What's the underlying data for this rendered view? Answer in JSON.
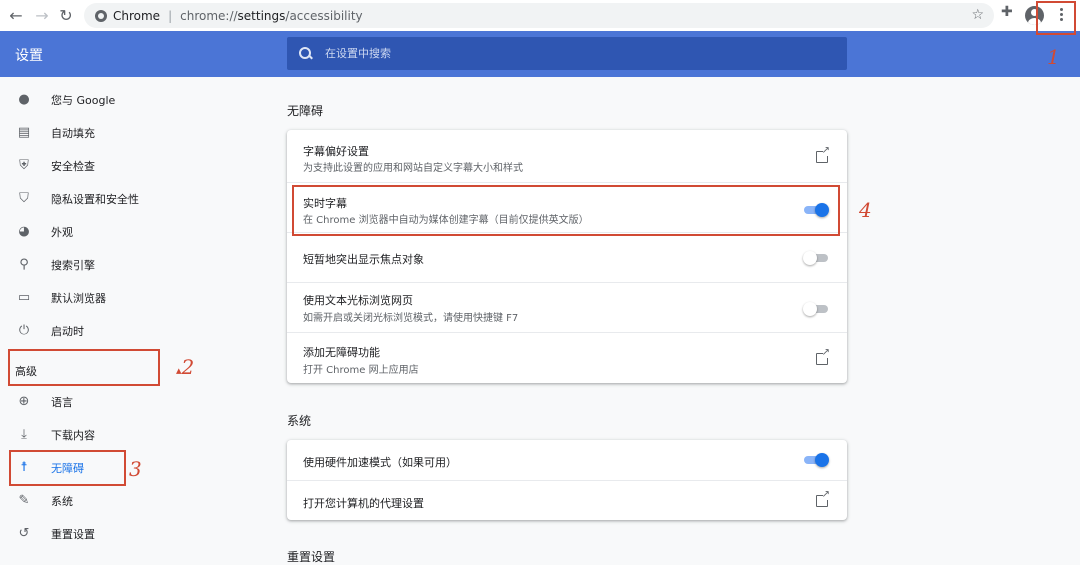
{
  "browser": {
    "tab_label": "Chrome",
    "url_prefix": "chrome://",
    "url_page": "settings",
    "url_suffix": "/accessibility"
  },
  "header": {
    "title": "设置",
    "search_placeholder": "在设置中搜索"
  },
  "sidebar": {
    "items": [
      {
        "label": "您与 Google",
        "icon": "person-icon"
      },
      {
        "label": "自动填充",
        "icon": "clipboard-icon"
      },
      {
        "label": "安全检查",
        "icon": "shield-check-icon"
      },
      {
        "label": "隐私设置和安全性",
        "icon": "shield-icon"
      },
      {
        "label": "外观",
        "icon": "palette-icon"
      },
      {
        "label": "搜索引擎",
        "icon": "search-icon"
      },
      {
        "label": "默认浏览器",
        "icon": "browser-icon"
      },
      {
        "label": "启动时",
        "icon": "power-icon"
      }
    ],
    "advanced_label": "高级",
    "advanced_items": [
      {
        "label": "语言",
        "icon": "globe-icon"
      },
      {
        "label": "下载内容",
        "icon": "download-icon"
      },
      {
        "label": "无障碍",
        "icon": "accessibility-icon",
        "active": true
      },
      {
        "label": "系统",
        "icon": "wrench-icon"
      },
      {
        "label": "重置设置",
        "icon": "restore-icon"
      }
    ]
  },
  "accessibility": {
    "section_title": "无障碍",
    "rows": [
      {
        "title": "字幕偏好设置",
        "subtitle": "为支持此设置的应用和网站自定义字幕大小和样式",
        "control": "external"
      },
      {
        "title": "实时字幕",
        "subtitle": "在 Chrome 浏览器中自动为媒体创建字幕（目前仅提供英文版）",
        "control": "toggle",
        "on": true
      },
      {
        "title": "短暂地突出显示焦点对象",
        "control": "toggle",
        "on": false
      },
      {
        "title": "使用文本光标浏览网页",
        "subtitle": "如需开启或关闭光标浏览模式，请使用快捷键 F7",
        "control": "toggle",
        "on": false
      },
      {
        "title": "添加无障碍功能",
        "subtitle": "打开 Chrome 网上应用店",
        "control": "external"
      }
    ]
  },
  "system": {
    "section_title": "系统",
    "rows": [
      {
        "title": "使用硬件加速模式（如果可用）",
        "control": "toggle",
        "on": true
      },
      {
        "title": "打开您计算机的代理设置",
        "control": "external"
      }
    ]
  },
  "reset": {
    "section_title": "重置设置"
  },
  "annotations": {
    "n1": "1",
    "n2": "2",
    "n3": "3",
    "n4": "4",
    "color": "#d14a34"
  },
  "colors": {
    "header_bg": "#4b75d6",
    "accent": "#1a73e8"
  }
}
